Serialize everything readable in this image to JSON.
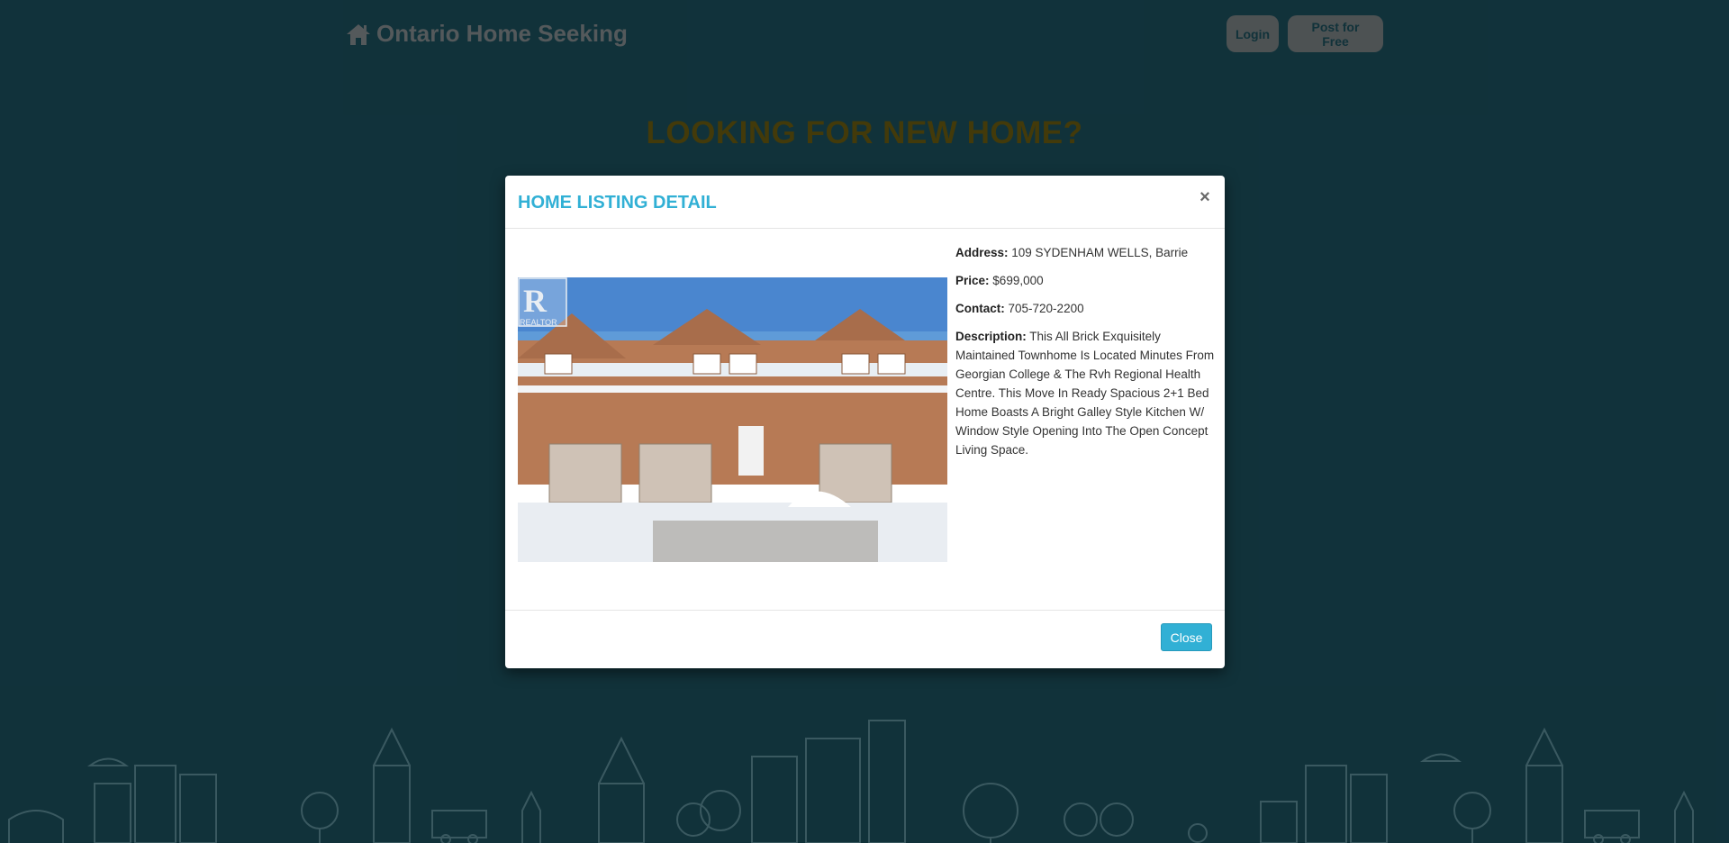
{
  "navbar": {
    "brand": "Ontario Home Seeking",
    "login_label": "Login",
    "post_label": "Post for Free"
  },
  "hero": {
    "title": "LOOKING FOR NEW HOME?"
  },
  "modal": {
    "title": "HOME LISTING DETAIL",
    "close_symbol": "×",
    "photo_watermark": "REALTOR",
    "address_label": "Address:",
    "address_value": "109 SYDENHAM WELLS, Barrie",
    "price_label": "Price:",
    "price_value": "$699,000",
    "contact_label": "Contact:",
    "contact_value": "705-720-2200",
    "description_label": "Description:",
    "description_value": "This All Brick Exquisitely Maintained Townhome Is Located Minutes From Georgian College & The Rvh Regional Health Centre. This Move In Ready Spacious 2+1 Bed Home Boasts A Bright Galley Style Kitchen W/ Window Style Opening Into The Open Concept Living Space.",
    "close_button": "Close"
  },
  "colors": {
    "background": "#1f5b6b",
    "accent": "#31b0d5",
    "hero_text": "#7a6a13"
  }
}
